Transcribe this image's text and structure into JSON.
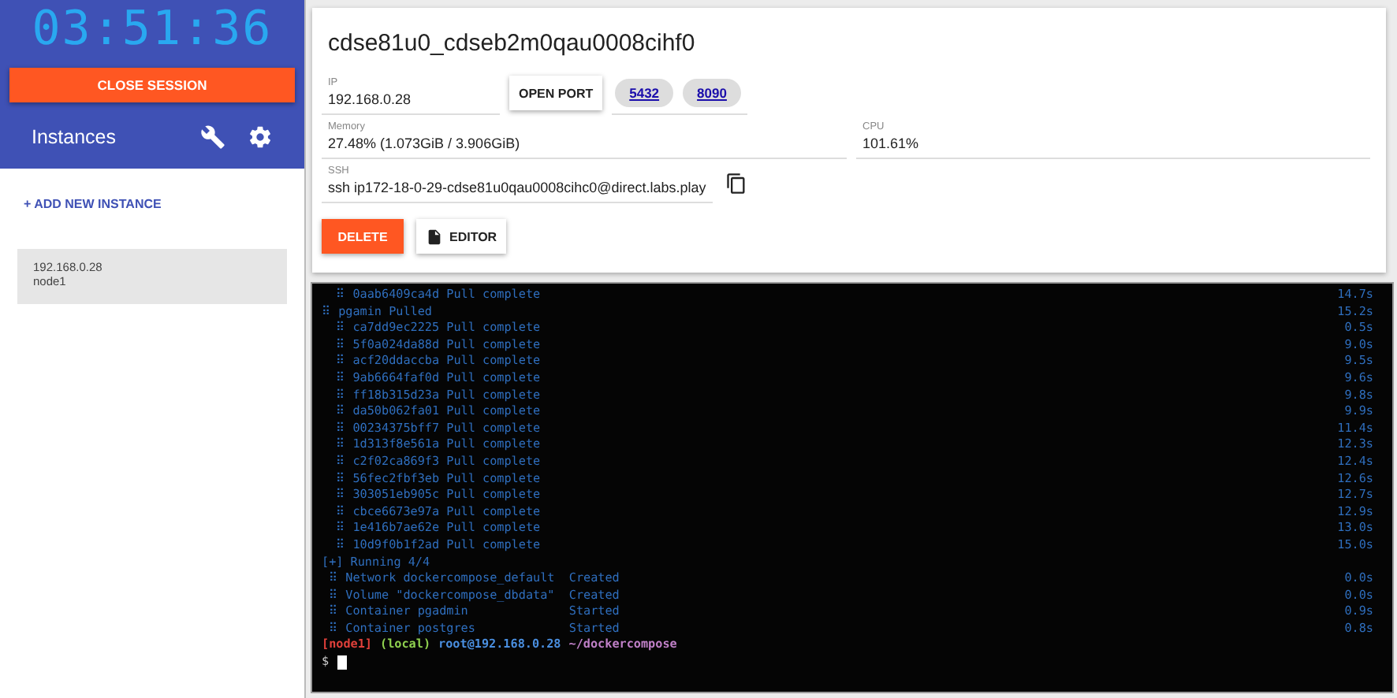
{
  "sidebar": {
    "timer": "03:51:36",
    "close_button": "CLOSE SESSION",
    "instances_title": "Instances",
    "add_instance": "+ ADD NEW INSTANCE",
    "instances": [
      {
        "ip": "192.168.0.28",
        "name": "node1",
        "selected": true
      }
    ]
  },
  "instance": {
    "title": "cdse81u0_cdseb2m0qau0008cihf0",
    "ip_label": "IP",
    "ip": "192.168.0.28",
    "open_port": "OPEN PORT",
    "ports": [
      "5432",
      "8090"
    ],
    "memory_label": "Memory",
    "memory": "27.48% (1.073GiB / 3.906GiB)",
    "cpu_label": "CPU",
    "cpu": "101.61%",
    "ssh_label": "SSH",
    "ssh": "ssh ip172-18-0-29-cdse81u0qau0008cihc0@direct.labs.play",
    "delete": "DELETE",
    "editor": "EDITOR"
  },
  "terminal": {
    "lines": [
      {
        "text": "  ⠿ 0aab6409ca4d Pull complete",
        "time": "14.7s"
      },
      {
        "text": "⠿ pgamin Pulled",
        "time": "15.2s"
      },
      {
        "text": "  ⠿ ca7dd9ec2225 Pull complete",
        "time": "0.5s"
      },
      {
        "text": "  ⠿ 5f0a024da88d Pull complete",
        "time": "9.0s"
      },
      {
        "text": "  ⠿ acf20ddaccba Pull complete",
        "time": "9.5s"
      },
      {
        "text": "  ⠿ 9ab6664faf0d Pull complete",
        "time": "9.6s"
      },
      {
        "text": "  ⠿ ff18b315d23a Pull complete",
        "time": "9.8s"
      },
      {
        "text": "  ⠿ da50b062fa01 Pull complete",
        "time": "9.9s"
      },
      {
        "text": "  ⠿ 00234375bff7 Pull complete",
        "time": "11.4s"
      },
      {
        "text": "  ⠿ 1d313f8e561a Pull complete",
        "time": "12.3s"
      },
      {
        "text": "  ⠿ c2f02ca869f3 Pull complete",
        "time": "12.4s"
      },
      {
        "text": "  ⠿ 56fec2fbf3eb Pull complete",
        "time": "12.6s"
      },
      {
        "text": "  ⠿ 303051eb905c Pull complete",
        "time": "12.7s"
      },
      {
        "text": "  ⠿ cbce6673e97a Pull complete",
        "time": "12.9s"
      },
      {
        "text": "  ⠿ 1e416b7ae62e Pull complete",
        "time": "13.0s"
      },
      {
        "text": "  ⠿ 10d9f0b1f2ad Pull complete",
        "time": "15.0s"
      },
      {
        "text": "[+] Running 4/4"
      },
      {
        "text": " ⠿ Network dockercompose_default  Created",
        "time": "0.0s"
      },
      {
        "text": " ⠿ Volume \"dockercompose_dbdata\"  Created",
        "time": "0.0s"
      },
      {
        "text": " ⠿ Container pgadmin              Started",
        "time": "0.9s"
      },
      {
        "text": " ⠿ Container postgres             Started",
        "time": "0.8s"
      }
    ],
    "prompt": [
      {
        "text": "[node1]",
        "color": "#e0403a"
      },
      {
        "text": "(local)",
        "color": "#8fd14f"
      },
      {
        "text": "root@192.168.0.28",
        "color": "#4a8fe0"
      },
      {
        "text": "~/dockercompose",
        "color": "#c080c8"
      }
    ],
    "input_prompt": "$"
  }
}
